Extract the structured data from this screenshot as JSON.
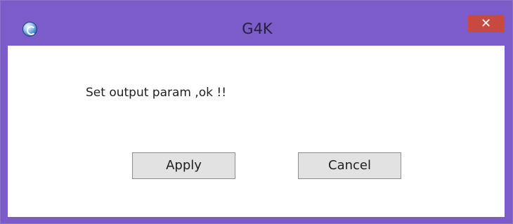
{
  "window": {
    "title": "G4K",
    "close_label": "✕",
    "app_icon": "g4k-logo-icon",
    "frame_color": "#7b5cc8",
    "close_color": "#c7493f"
  },
  "dialog": {
    "message": "Set output param ,ok !!",
    "apply_label": "Apply",
    "cancel_label": "Cancel"
  }
}
